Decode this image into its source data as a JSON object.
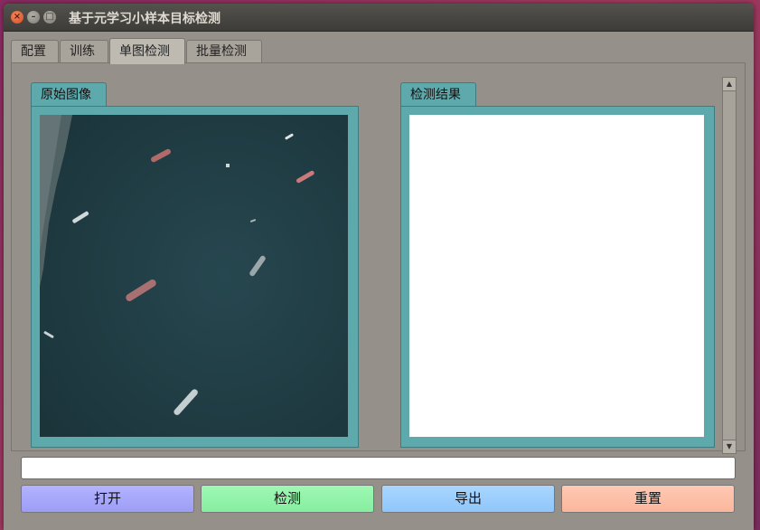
{
  "window": {
    "title": "基于元学习小样本目标检测"
  },
  "tabs": [
    {
      "label": "配置",
      "active": false
    },
    {
      "label": "训练",
      "active": false
    },
    {
      "label": "单图检测",
      "active": true
    },
    {
      "label": "批量检测",
      "active": false
    }
  ],
  "panels": {
    "original": {
      "label": "原始图像",
      "image": "aerial-photo-of-ships-on-sea"
    },
    "result": {
      "label": "检测结果"
    }
  },
  "path_field": {
    "value": ""
  },
  "buttons": {
    "open": "打开",
    "detect": "检测",
    "export": "导出",
    "reset": "重置"
  },
  "colors": {
    "group_teal": "#5ea9ac",
    "open_button": "#a7a7fb",
    "detect_button": "#93f2a9",
    "export_button": "#9bcefc",
    "reset_button": "#fdbfa7"
  }
}
